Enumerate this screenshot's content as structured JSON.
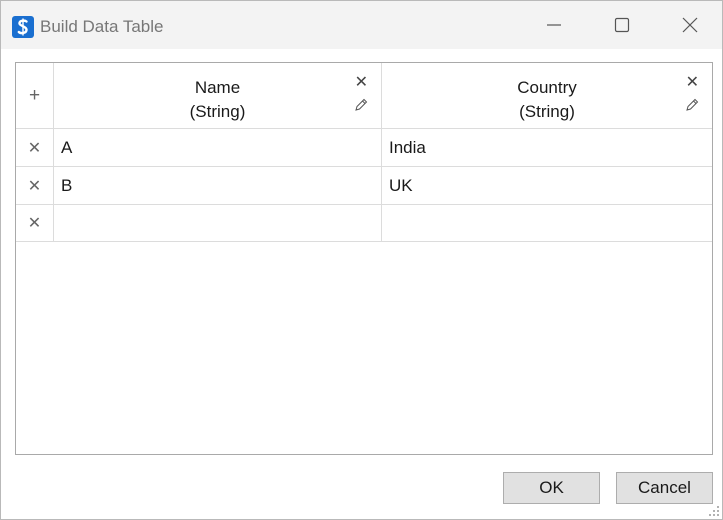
{
  "window": {
    "title": "Build Data Table",
    "icon": "app-s-icon"
  },
  "titlebar_buttons": {
    "minimize_icon": "minimize-icon",
    "maximize_icon": "maximize-icon",
    "close_icon": "close-icon"
  },
  "table": {
    "add_row_glyph": "+",
    "remove_glyph": "✕",
    "columns": [
      {
        "name": "Name",
        "type": "(String)"
      },
      {
        "name": "Country",
        "type": "(String)"
      }
    ],
    "rows": [
      [
        "A",
        "India"
      ],
      [
        "B",
        "UK"
      ],
      [
        "",
        ""
      ]
    ]
  },
  "buttons": {
    "ok_label": "OK",
    "cancel_label": "Cancel"
  },
  "colors": {
    "app_icon": "#1a6fd0",
    "button_bg": "#e1e1e1",
    "titlebar_bg": "#f3f3f3"
  }
}
